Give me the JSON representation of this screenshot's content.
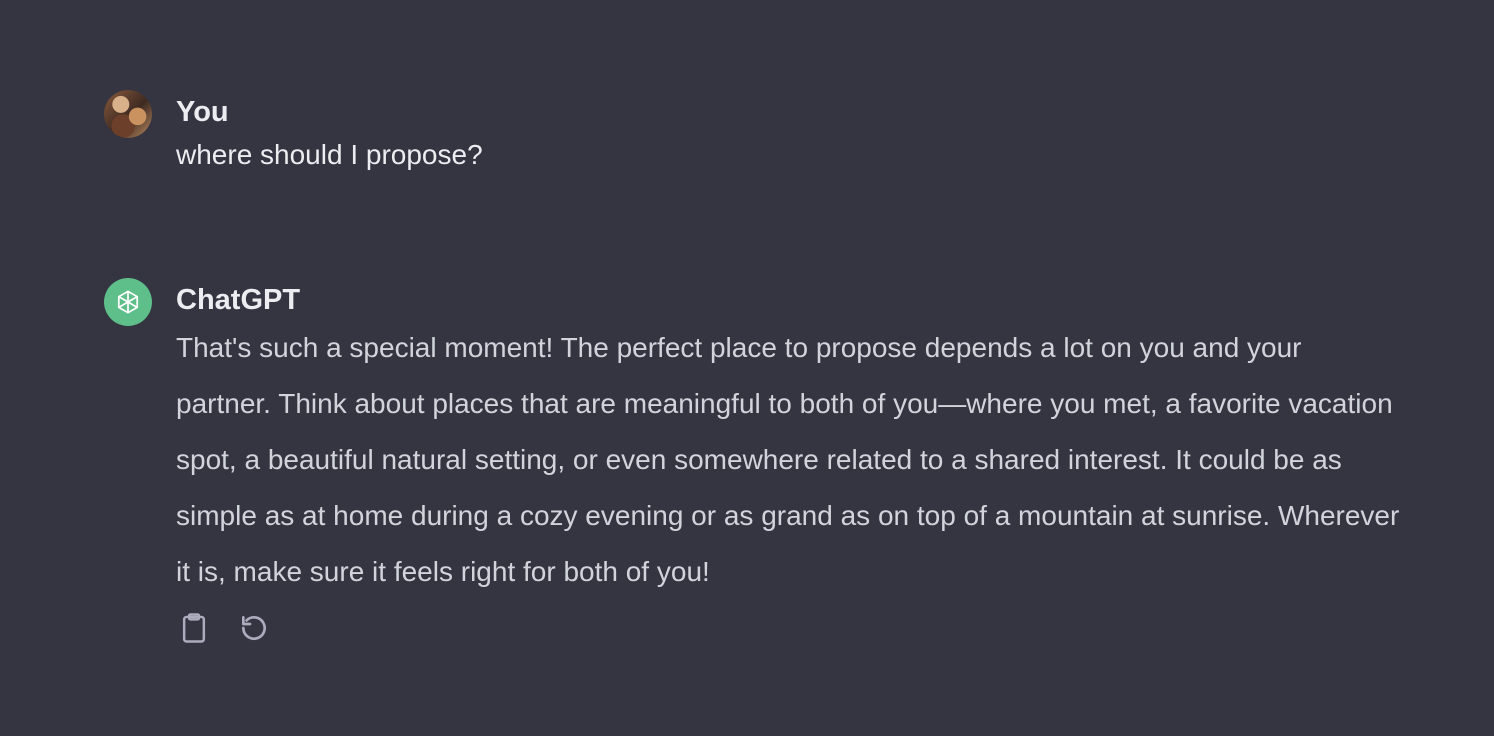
{
  "conversation": {
    "user_message": {
      "author": "You",
      "text": "where should I propose?",
      "avatar_icon": "user-photo-avatar"
    },
    "assistant_message": {
      "author": "ChatGPT",
      "text": "That's such a special moment! The perfect place to propose depends a lot on you and your partner. Think about places that are meaningful to both of you—where you met, a favorite vacation spot, a beautiful natural setting, or even somewhere related to a shared interest. It could be as simple as at home during a cozy evening or as grand as on top of a mountain at sunrise. Wherever it is, make sure it feels right for both of you!",
      "avatar_icon": "openai-logo-icon",
      "actions": [
        {
          "icon": "clipboard-icon"
        },
        {
          "icon": "regenerate-icon"
        }
      ]
    }
  },
  "colors": {
    "background": "#343541",
    "author_text": "#ececf1",
    "body_text": "#d1d5db",
    "bot_avatar": "#5fbf8a",
    "icon": "#acacbe"
  }
}
